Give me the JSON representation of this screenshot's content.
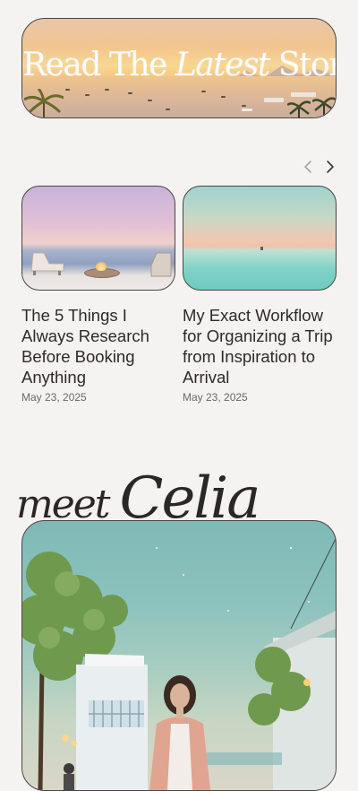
{
  "hero": {
    "title_part1": "Read The ",
    "title_italic": "Latest",
    "title_part2": " Stories"
  },
  "carousel": {
    "prev_icon": "chevron-left-icon",
    "next_icon": "chevron-right-icon"
  },
  "posts": [
    {
      "title": "The 5 Things I Always Research Before Booking Anything",
      "date": "May 23, 2025"
    },
    {
      "title": "My Exact Workflow for Organizing a Trip from Inspiration to Arrival",
      "date": "May 23, 2025"
    }
  ],
  "meet": {
    "word1": "meet ",
    "word2": "Celia"
  },
  "colors": {
    "background": "#f4f3f1",
    "text": "#2e2a27",
    "border": "#4a4440",
    "date": "#6e6864"
  }
}
